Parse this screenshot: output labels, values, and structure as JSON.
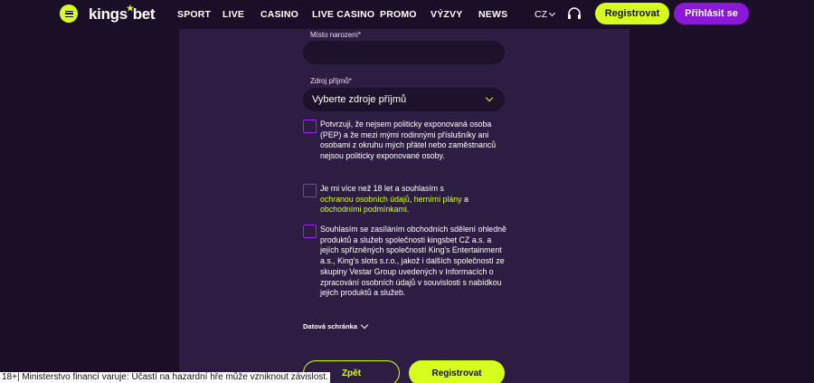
{
  "header": {
    "logo_text": "kingsbet",
    "nav": [
      "SPORT",
      "LIVE",
      "CASINO",
      "LIVE CASINO",
      "PROMO",
      "VÝZVY",
      "NEWS"
    ],
    "language": "CZ",
    "register_label": "Registrovat",
    "login_label": "Přihlásit se"
  },
  "form": {
    "birthplace_label": "Místo narození*",
    "birthplace_value": "",
    "income_label": "Zdroj příjmů*",
    "income_placeholder": "Vyberte zdroje příjmů",
    "pep_text": "Potvrzuji, že nejsem politicky exponovaná osoba (PEP) a že mezi mými rodinnými příslušníky ani osobami z okruhu mých přátel nebo zaměstnanců nejsou politicky exponované osoby.",
    "age_prefix": "Je mi více než 18 let a souhlasím s",
    "age_link1": "ochranou osobních údajů",
    "age_sep": ",",
    "age_link2": "herními plány",
    "age_and": "a",
    "age_link3": "obchodními podmínkami",
    "age_end": ".",
    "marketing_text": "Souhlasím se zasíláním obchodních sdělení ohledně produktů a služeb společnosti kingsbet CZ a.s. a jejích spřízněných společností King's Entertainment a.s., King's slots s.r.o., jakož i dalších společností ze skupiny Vestar Group uvedených v Informacích o zpracování osobních údajů v souvislosti s nabídkou jejich produktů a služeb.",
    "datova_label": "Datová schránka",
    "back_label": "Zpět",
    "submit_label": "Registrovat"
  },
  "footer_warning": "18+| Ministerstvo financí varuje: Účastí na hazardní hře může vzniknout závislost.",
  "colors": {
    "accent": "#d6ff1e",
    "brand_purple": "#8b18d6",
    "background": "#1a0f26",
    "panel": "#2e1d42"
  }
}
